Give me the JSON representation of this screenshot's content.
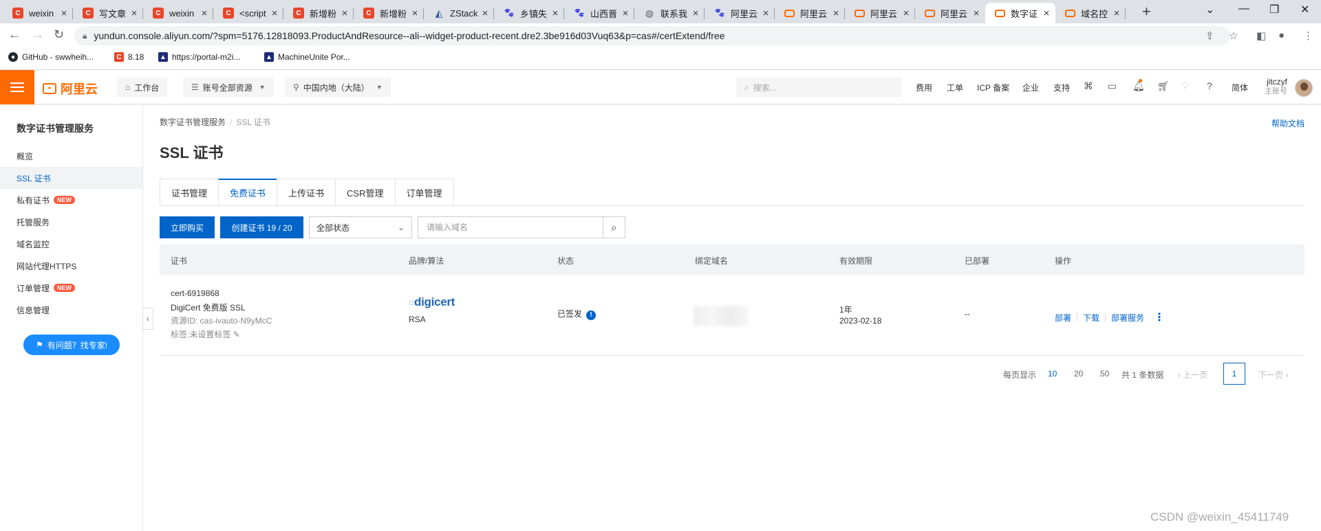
{
  "browser": {
    "tabs": [
      {
        "title": "weixin",
        "icon": "C"
      },
      {
        "title": "写文章",
        "icon": "C"
      },
      {
        "title": "weixin",
        "icon": "C"
      },
      {
        "title": "<script",
        "icon": "C"
      },
      {
        "title": "新增粉",
        "icon": "C"
      },
      {
        "title": "新增粉",
        "icon": "C"
      },
      {
        "title": "ZStack",
        "icon": "Z"
      },
      {
        "title": "乡镇失",
        "icon": "paw"
      },
      {
        "title": "山西晋",
        "icon": "paw"
      },
      {
        "title": "联系我",
        "icon": "globe"
      },
      {
        "title": "阿里云",
        "icon": "paw"
      },
      {
        "title": "阿里云",
        "icon": "ali"
      },
      {
        "title": "阿里云",
        "icon": "ali"
      },
      {
        "title": "阿里云",
        "icon": "ali"
      },
      {
        "title": "数字证",
        "icon": "ali"
      },
      {
        "title": "域名控",
        "icon": "ali"
      }
    ],
    "active_tab_index": 14,
    "url": "yundun.console.aliyun.com/?spm=5176.12818093.ProductAndResource--ali--widget-product-recent.dre2.3be916d03Vuq63&p=cas#/certExtend/free",
    "bookmarks": [
      {
        "label": "GitHub - swwheih...",
        "icon": "github-icon"
      },
      {
        "label": "8.18",
        "icon": "csdn-icon"
      },
      {
        "label": "https://portal-m2i...",
        "icon": "triangle-icon"
      },
      {
        "label": "MachineUnite Por...",
        "icon": "triangle-icon"
      }
    ]
  },
  "header": {
    "logo": "阿里云",
    "workbench": "工作台",
    "account_resources": "账号全部资源",
    "region": "中国内地（大陆）",
    "search_placeholder": "搜索...",
    "links": [
      "费用",
      "工单",
      "ICP 备案",
      "企业",
      "支持"
    ],
    "lang": "简体",
    "user_name": "jitczyf",
    "user_role": "主账号"
  },
  "sidebar": {
    "title": "数字证书管理服务",
    "items": [
      {
        "label": "概览",
        "badge": ""
      },
      {
        "label": "SSL 证书",
        "badge": ""
      },
      {
        "label": "私有证书",
        "badge": "NEW"
      },
      {
        "label": "托管服务",
        "badge": ""
      },
      {
        "label": "域名监控",
        "badge": ""
      },
      {
        "label": "网站代理HTTPS",
        "badge": ""
      },
      {
        "label": "订单管理",
        "badge": "NEW"
      },
      {
        "label": "信息管理",
        "badge": ""
      }
    ],
    "active_index": 1,
    "help_button": "有问题？找专家!"
  },
  "main": {
    "breadcrumb": [
      "数字证书管理服务",
      "SSL 证书"
    ],
    "help_doc": "帮助文档",
    "title": "SSL 证书",
    "tabs": [
      "证书管理",
      "免费证书",
      "上传证书",
      "CSR管理",
      "订单管理"
    ],
    "active_tab": 1,
    "buy_button": "立即购买",
    "create_button": "创建证书 19 / 20",
    "status_select": "全部状态",
    "domain_placeholder": "请输入域名",
    "columns": [
      "证书",
      "品牌/算法",
      "状态",
      "绑定域名",
      "有效期限",
      "已部署",
      "操作"
    ],
    "rows": [
      {
        "cert_id": "cert-6919868",
        "cert_name": "DigiCert 免费版 SSL",
        "resource_id": "资源ID: cas-ivauto-N9yMcC",
        "tag": "标签:未设置标签",
        "brand": "digicert",
        "algorithm": "RSA",
        "status": "已签发",
        "validity": "1年",
        "expire": "2023-02-18",
        "deployed": "--",
        "actions": [
          "部署",
          "下载",
          "部署服务"
        ]
      }
    ],
    "pagination": {
      "page_size_label": "每页显示",
      "sizes": [
        "10",
        "20",
        "50"
      ],
      "active_size": "10",
      "total": "共 1 条数据",
      "prev": "上一页",
      "page": "1",
      "next": "下一页"
    }
  },
  "watermark": "CSDN @weixin_45411749",
  "colors": {
    "brand": "#ff6a00",
    "primary": "#0064c8",
    "badge": "#ff5a3c"
  }
}
